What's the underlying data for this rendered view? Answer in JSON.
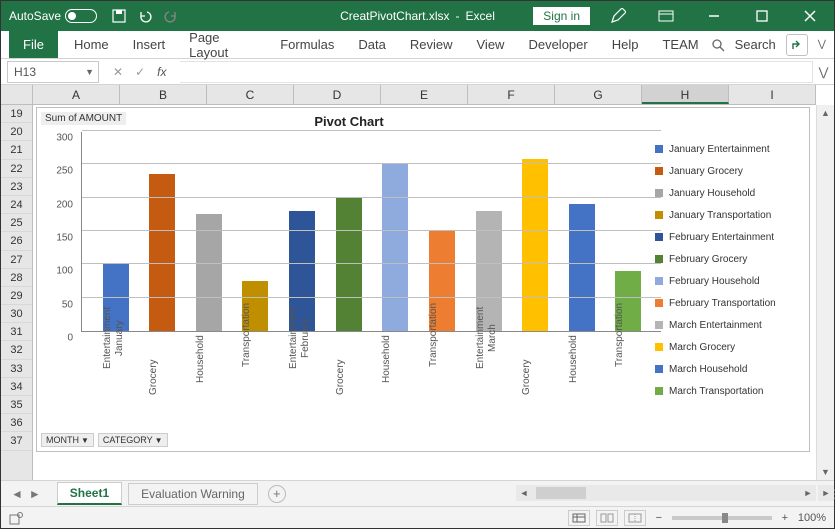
{
  "titlebar": {
    "autosave_label": "AutoSave",
    "autosave_state": "Off",
    "filename": "CreatPivotChart.xlsx",
    "app": "Excel",
    "signin": "Sign in"
  },
  "ribbon": {
    "file": "File",
    "tabs": [
      "Home",
      "Insert",
      "Page Layout",
      "Formulas",
      "Data",
      "Review",
      "View",
      "Developer",
      "Help",
      "TEAM"
    ],
    "search": "Search"
  },
  "namebox": {
    "value": "H13"
  },
  "columns": [
    "A",
    "B",
    "C",
    "D",
    "E",
    "F",
    "G",
    "H",
    "I"
  ],
  "rows": [
    "19",
    "20",
    "21",
    "22",
    "23",
    "24",
    "25",
    "26",
    "27",
    "28",
    "29",
    "30",
    "31",
    "32",
    "33",
    "34",
    "35",
    "36",
    "37"
  ],
  "chart_header_small": "Sum of AMOUNT",
  "pivot_buttons": {
    "month": "MONTH",
    "category": "CATEGORY"
  },
  "pivot_title": "Pivot Chart",
  "chart_data": {
    "type": "bar",
    "title": "Pivot Chart",
    "ylabel": "",
    "xlabel": "",
    "ylim": [
      0,
      300
    ],
    "yticks": [
      0,
      50,
      100,
      150,
      200,
      250,
      300
    ],
    "categories": [
      {
        "group": "January",
        "item": "Entertainment"
      },
      {
        "group": "",
        "item": "Grocery"
      },
      {
        "group": "",
        "item": "Household"
      },
      {
        "group": "",
        "item": "Transportation"
      },
      {
        "group": "February",
        "item": "Entertainment"
      },
      {
        "group": "",
        "item": "Grocery"
      },
      {
        "group": "",
        "item": "Household"
      },
      {
        "group": "",
        "item": "Transportation"
      },
      {
        "group": "March",
        "item": "Entertainment"
      },
      {
        "group": "",
        "item": "Grocery"
      },
      {
        "group": "",
        "item": "Household"
      },
      {
        "group": "",
        "item": "Transportation"
      }
    ],
    "values": [
      100,
      235,
      175,
      75,
      180,
      200,
      250,
      150,
      180,
      258,
      190,
      90
    ],
    "colors": [
      "#4472C4",
      "#C55A11",
      "#A6A6A6",
      "#BF8F00",
      "#2E5597",
      "#548235",
      "#8FAADC",
      "#ED7D31",
      "#B4B4B4",
      "#FFC000",
      "#4472C4",
      "#70AD47"
    ],
    "legend": [
      {
        "label": "January Entertainment",
        "color": "#4472C4"
      },
      {
        "label": "January Grocery",
        "color": "#C55A11"
      },
      {
        "label": "January Household",
        "color": "#A6A6A6"
      },
      {
        "label": "January Transportation",
        "color": "#BF8F00"
      },
      {
        "label": "February Entertainment",
        "color": "#2E5597"
      },
      {
        "label": "February Grocery",
        "color": "#548235"
      },
      {
        "label": "February Household",
        "color": "#8FAADC"
      },
      {
        "label": "February Transportation",
        "color": "#ED7D31"
      },
      {
        "label": "March Entertainment",
        "color": "#B4B4B4"
      },
      {
        "label": "March Grocery",
        "color": "#FFC000"
      },
      {
        "label": "March Household",
        "color": "#4472C4"
      },
      {
        "label": "March Transportation",
        "color": "#70AD47"
      }
    ]
  },
  "sheet_tabs": {
    "active": "Sheet1",
    "inactive": "Evaluation Warning"
  },
  "zoom": "100%"
}
